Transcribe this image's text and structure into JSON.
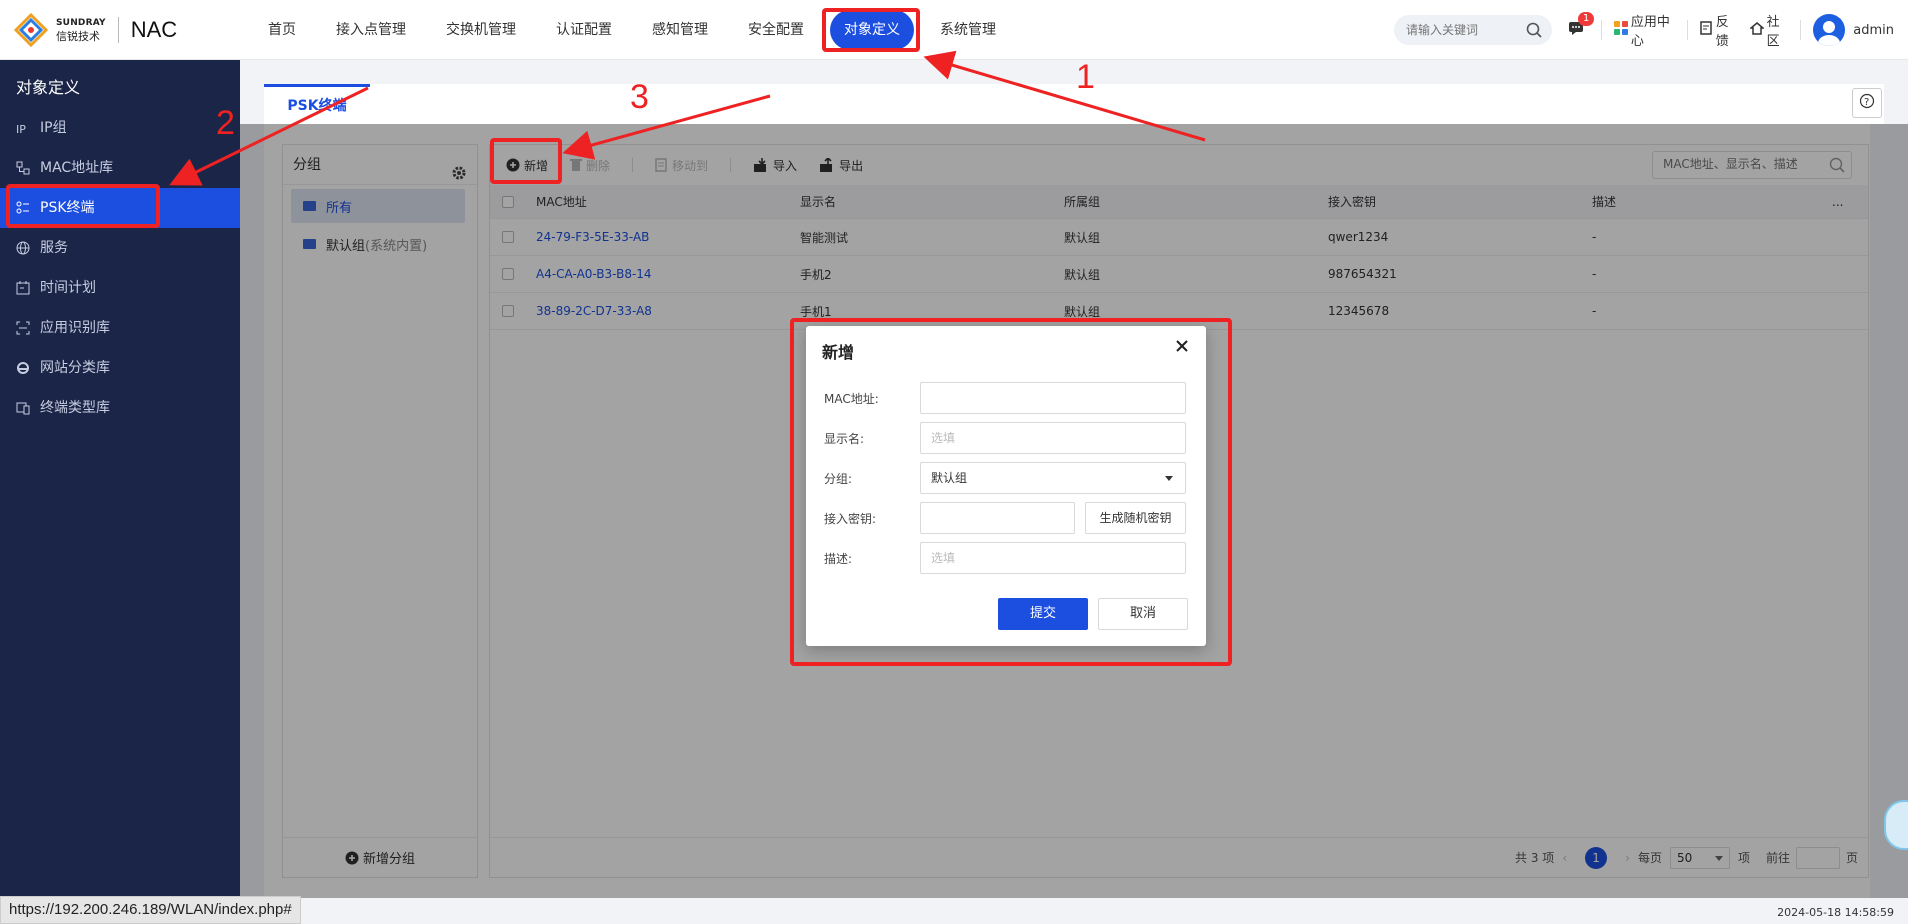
{
  "app": {
    "brand_en": "SUNDRAY",
    "brand_cn": "信锐技术",
    "product": "NAC"
  },
  "nav": {
    "items": [
      {
        "label": "首页"
      },
      {
        "label": "接入点管理"
      },
      {
        "label": "交换机管理"
      },
      {
        "label": "认证配置"
      },
      {
        "label": "感知管理"
      },
      {
        "label": "安全配置"
      },
      {
        "label": "对象定义",
        "active": true
      },
      {
        "label": "系统管理"
      }
    ],
    "search_placeholder": "请输入关键词",
    "message_badge": "1",
    "app_center": "应用中心",
    "feedback": "反馈",
    "community": "社区",
    "user": "admin"
  },
  "sidebar": {
    "title": "对象定义",
    "items": [
      {
        "label": "IP组",
        "icon": "ip-icon"
      },
      {
        "label": "MAC地址库",
        "icon": "mac-icon"
      },
      {
        "label": "PSK终端",
        "icon": "psk-icon",
        "active": true
      },
      {
        "label": "服务",
        "icon": "globe-icon"
      },
      {
        "label": "时间计划",
        "icon": "calendar-icon"
      },
      {
        "label": "应用识别库",
        "icon": "scan-icon"
      },
      {
        "label": "网站分类库",
        "icon": "web-icon"
      },
      {
        "label": "终端类型库",
        "icon": "device-icon"
      }
    ]
  },
  "tab": {
    "label": "PSK终端"
  },
  "groups": {
    "header": "分组",
    "items": [
      {
        "label": "所有",
        "suffix": ""
      },
      {
        "label": "默认组",
        "suffix": "(系统内置)"
      }
    ],
    "add_label": "新增分组"
  },
  "toolbar": {
    "add": "新增",
    "delete": "删除",
    "move": "移动到",
    "import": "导入",
    "export": "导出",
    "search_placeholder": "MAC地址、显示名、描述"
  },
  "table": {
    "columns": [
      "MAC地址",
      "显示名",
      "所属组",
      "接入密钥",
      "描述",
      "..."
    ],
    "rows": [
      {
        "mac": "24-79-F3-5E-33-AB",
        "name": "智能测试",
        "group": "默认组",
        "key": "qwer1234",
        "desc": "-"
      },
      {
        "mac": "A4-CA-A0-B3-B8-14",
        "name": "手机2",
        "group": "默认组",
        "key": "987654321",
        "desc": "-"
      },
      {
        "mac": "38-89-2C-D7-33-A8",
        "name": "手机1",
        "group": "默认组",
        "key": "12345678",
        "desc": "-"
      }
    ]
  },
  "pager": {
    "total": "共 3 项",
    "current_page": "1",
    "per_page_label": "每页",
    "per_page": "50",
    "unit": "项",
    "goto": "前往",
    "page_unit": "页"
  },
  "modal": {
    "title": "新增",
    "fields": {
      "mac_label": "MAC地址:",
      "mac_value": "",
      "name_label": "显示名:",
      "name_placeholder": "选填",
      "group_label": "分组:",
      "group_value": "默认组",
      "key_label": "接入密钥:",
      "key_value": "",
      "gen_button": "生成随机密钥",
      "desc_label": "描述:",
      "desc_placeholder": "选填"
    },
    "submit": "提交",
    "cancel": "取消"
  },
  "annotations": {
    "n1": "1",
    "n2": "2",
    "n3": "3",
    "color": "#ee2222"
  },
  "statusbar": {
    "url": "https://192.200.246.189/WLAN/index.php#",
    "datetime": "2024-05-18 14:58:59"
  },
  "colors": {
    "accent": "#1c4fe0",
    "sidebar_bg": "#1b2547"
  }
}
